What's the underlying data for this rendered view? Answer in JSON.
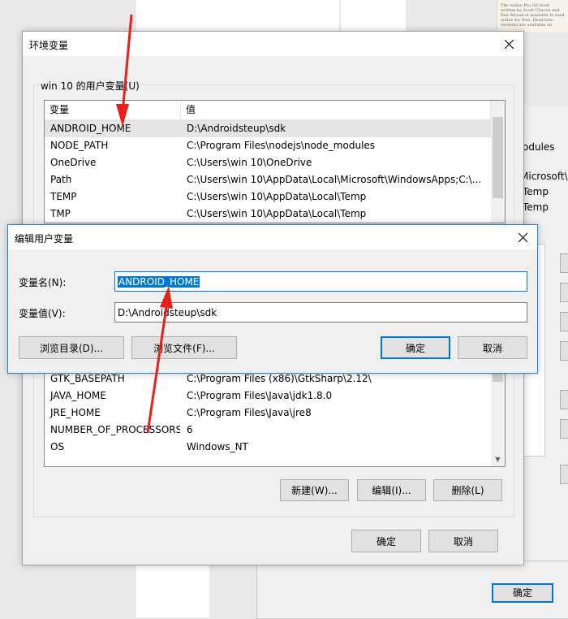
{
  "background": {
    "right_panel_texts": [
      "odules",
      "Microsoft\\W",
      "Temp",
      "Temp"
    ],
    "bottom_ok_label": "确定",
    "book_snippet": "The online Pro Git book written by Scott Chacon and Ben Straub is available to read online for free. Dead tree versions are available on"
  },
  "env_dialog": {
    "title": "环境变量",
    "user_group_label": "win 10 的用户变量(U)",
    "columns": [
      "变量",
      "值"
    ],
    "top_rows": [
      {
        "name": "ANDROID_HOME",
        "value": "D:\\Androidsteup\\sdk",
        "selected": true
      },
      {
        "name": "NODE_PATH",
        "value": "C:\\Program Files\\nodejs\\node_modules",
        "selected": false
      },
      {
        "name": "OneDrive",
        "value": "C:\\Users\\win 10\\OneDrive",
        "selected": false
      },
      {
        "name": "Path",
        "value": "C:\\Users\\win 10\\AppData\\Local\\Microsoft\\WindowsApps;C:\\...",
        "selected": false
      },
      {
        "name": "TEMP",
        "value": "C:\\Users\\win 10\\AppData\\Local\\Temp",
        "selected": false
      },
      {
        "name": "TMP",
        "value": "C:\\Users\\win 10\\AppData\\Local\\Temp",
        "selected": false
      }
    ],
    "system_rows": [
      {
        "name": "GTK_BASEPATH",
        "value": "C:\\Program Files (x86)\\GtkSharp\\2.12\\"
      },
      {
        "name": "JAVA_HOME",
        "value": "C:\\Program Files\\Java\\jdk1.8.0"
      },
      {
        "name": "JRE_HOME",
        "value": "C:\\Program Files\\Java\\jre8"
      },
      {
        "name": "NUMBER_OF_PROCESSORS",
        "value": "6"
      },
      {
        "name": "OS",
        "value": "Windows_NT"
      }
    ],
    "new_label": "新建(W)...",
    "edit_label": "编辑(I)...",
    "delete_label": "删除(L)",
    "ok_label": "确定",
    "cancel_label": "取消"
  },
  "edit_dialog": {
    "title": "编辑用户变量",
    "name_label": "变量名(N):",
    "name_value": "ANDROID_HOME",
    "value_label": "变量值(V):",
    "value_value": "D:\\Androidsteup\\sdk",
    "browse_dir_label": "浏览目录(D)...",
    "browse_file_label": "浏览文件(F)...",
    "ok_label": "确定",
    "cancel_label": "取消"
  },
  "annotation_color": "#e8201a",
  "icons": [
    "close-icon",
    "scroll-up-icon",
    "scroll-down-icon"
  ]
}
